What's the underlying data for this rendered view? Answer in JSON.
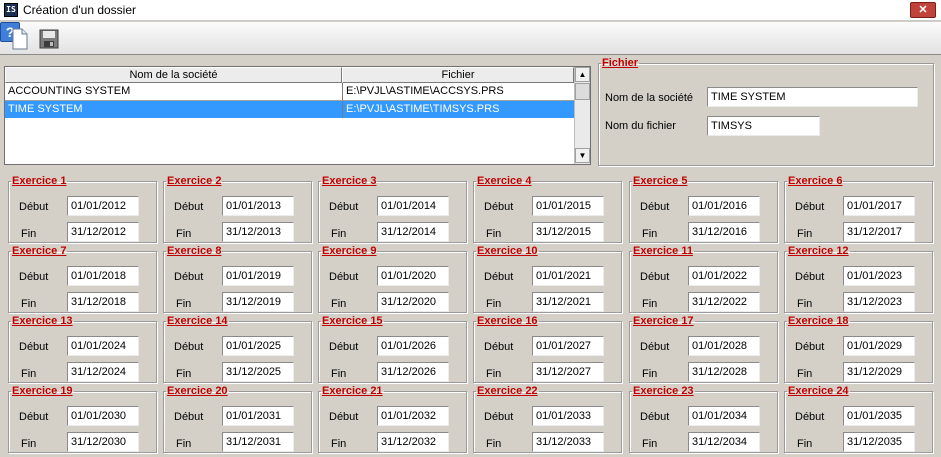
{
  "window": {
    "title": "Création d'un dossier",
    "close_glyph": "✕",
    "app_icon_text": "IS"
  },
  "toolbar": {
    "help_glyph": "?"
  },
  "grid": {
    "headers": [
      "Nom de la société",
      "Fichier"
    ],
    "rows": [
      {
        "name": "ACCOUNTING SYSTEM",
        "file": "E:\\PVJL\\ASTIME\\ACCSYS.PRS",
        "selected": false
      },
      {
        "name": "TIME SYSTEM",
        "file": "E:\\PVJL\\ASTIME\\TIMSYS.PRS",
        "selected": true
      }
    ],
    "scroll_up": "▲",
    "scroll_down": "▼"
  },
  "fichier": {
    "legend": "Fichier",
    "societe_label": "Nom de la société",
    "societe_value": "TIME SYSTEM",
    "fichier_label": "Nom du fichier",
    "fichier_value": "TIMSYS"
  },
  "exercice_labels": {
    "debut": "Début",
    "fin": "Fin"
  },
  "exercices": [
    {
      "title": "Exercice 1",
      "debut": "01/01/2012",
      "fin": "31/12/2012"
    },
    {
      "title": "Exercice 2",
      "debut": "01/01/2013",
      "fin": "31/12/2013"
    },
    {
      "title": "Exercice 3",
      "debut": "01/01/2014",
      "fin": "31/12/2014"
    },
    {
      "title": "Exercice 4",
      "debut": "01/01/2015",
      "fin": "31/12/2015"
    },
    {
      "title": "Exercice 5",
      "debut": "01/01/2016",
      "fin": "31/12/2016"
    },
    {
      "title": "Exercice 6",
      "debut": "01/01/2017",
      "fin": "31/12/2017"
    },
    {
      "title": "Exercice 7",
      "debut": "01/01/2018",
      "fin": "31/12/2018"
    },
    {
      "title": "Exercice 8",
      "debut": "01/01/2019",
      "fin": "31/12/2019"
    },
    {
      "title": "Exercice 9",
      "debut": "01/01/2020",
      "fin": "31/12/2020"
    },
    {
      "title": "Exercice 10",
      "debut": "01/01/2021",
      "fin": "31/12/2021"
    },
    {
      "title": "Exercice 11",
      "debut": "01/01/2022",
      "fin": "31/12/2022"
    },
    {
      "title": "Exercice 12",
      "debut": "01/01/2023",
      "fin": "31/12/2023"
    },
    {
      "title": "Exercice 13",
      "debut": "01/01/2024",
      "fin": "31/12/2024"
    },
    {
      "title": "Exercice 14",
      "debut": "01/01/2025",
      "fin": "31/12/2025"
    },
    {
      "title": "Exercice 15",
      "debut": "01/01/2026",
      "fin": "31/12/2026"
    },
    {
      "title": "Exercice 16",
      "debut": "01/01/2027",
      "fin": "31/12/2027"
    },
    {
      "title": "Exercice 17",
      "debut": "01/01/2028",
      "fin": "31/12/2028"
    },
    {
      "title": "Exercice 18",
      "debut": "01/01/2029",
      "fin": "31/12/2029"
    },
    {
      "title": "Exercice 19",
      "debut": "01/01/2030",
      "fin": "31/12/2030"
    },
    {
      "title": "Exercice 20",
      "debut": "01/01/2031",
      "fin": "31/12/2031"
    },
    {
      "title": "Exercice 21",
      "debut": "01/01/2032",
      "fin": "31/12/2032"
    },
    {
      "title": "Exercice 22",
      "debut": "01/01/2033",
      "fin": "31/12/2033"
    },
    {
      "title": "Exercice 23",
      "debut": "01/01/2034",
      "fin": "31/12/2034"
    },
    {
      "title": "Exercice 24",
      "debut": "01/01/2035",
      "fin": "31/12/2035"
    }
  ]
}
